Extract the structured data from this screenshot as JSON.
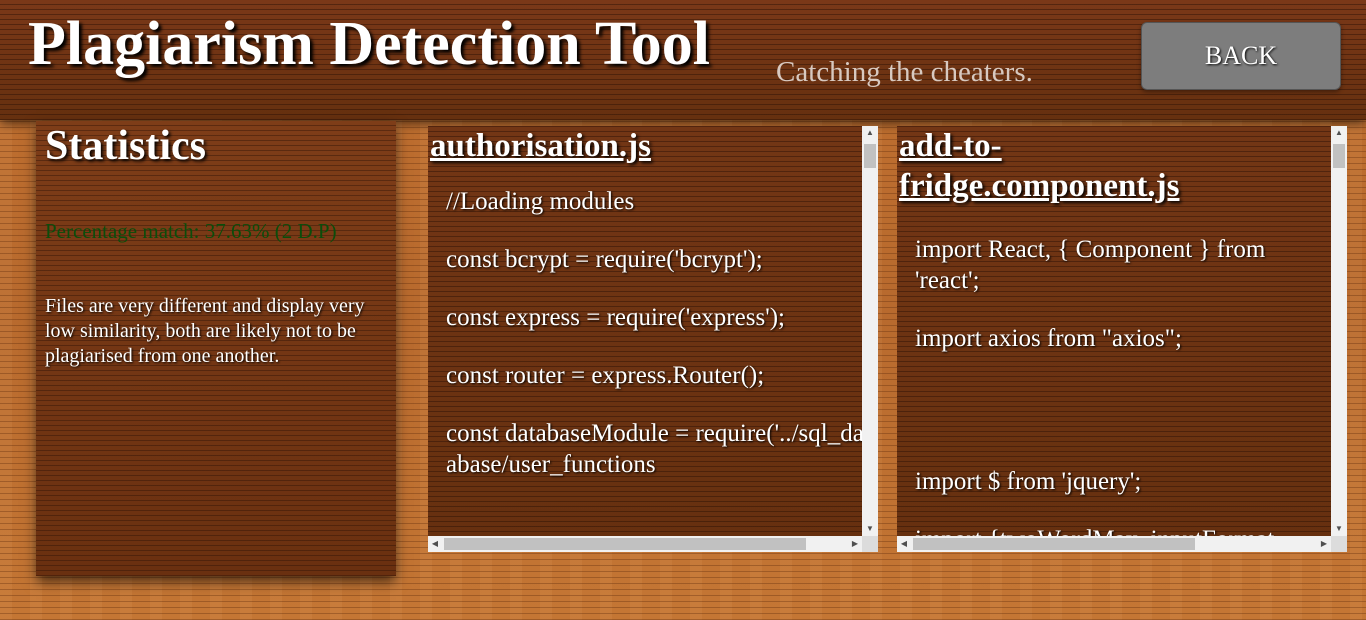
{
  "header": {
    "title": "Plagiarism Detection Tool",
    "subtitle": "Catching the cheaters.",
    "back_label": "BACK"
  },
  "stats": {
    "heading": "Statistics",
    "match_text": "Percentage match: 37.63% (2 D.P)",
    "verdict": "Files are very different and display very low similarity, both are likely not to be plagiarised from one another."
  },
  "file1": {
    "name": "authorisation.js",
    "lines": [
      "//Loading modules",
      "const bcrypt = require('bcrypt');",
      "const express = require('express');",
      "const router = express.Router();",
      "const databaseModule = require('../sql_database/user_functions"
    ]
  },
  "file2": {
    "name": "add-to-fridge.component.js",
    "lines": [
      "import React, { Component } from 'react';",
      "import axios from \"axios\";",
      " ",
      "import $ from 'jquery';",
      "import {twoWordMax, inputFormat, dateCheck, checkAttributes, Check"
    ]
  },
  "scrollbar_glyphs": {
    "up": "▲",
    "down": "▼",
    "left": "◀",
    "right": "▶"
  },
  "colors": {
    "match_text": "#0b4d0b",
    "back_button": "#7d7d7d",
    "header_wood": "#6e3214",
    "body_wood": "#b8682c"
  }
}
